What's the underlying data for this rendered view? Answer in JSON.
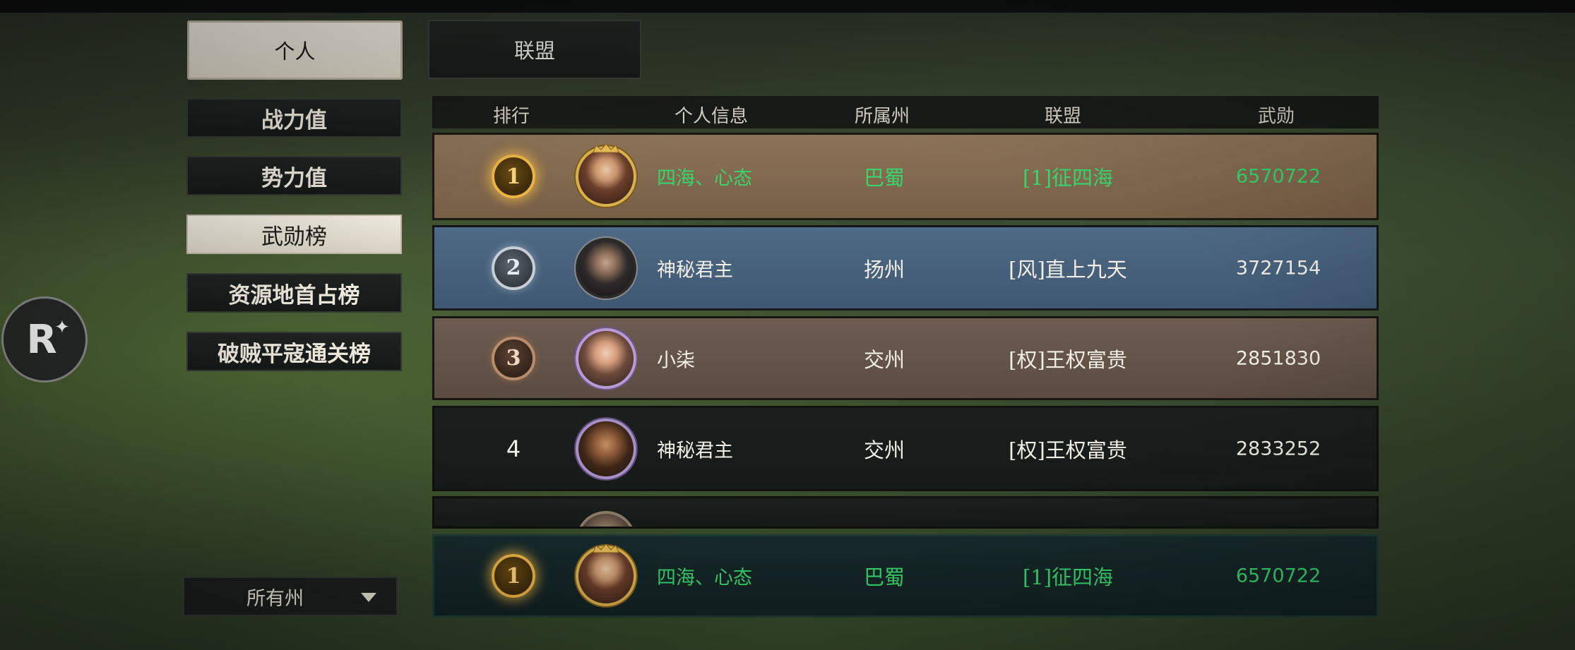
{
  "tabs": {
    "personal": "个人",
    "alliance": "联盟"
  },
  "sidebar": {
    "items": [
      {
        "label": "战力值",
        "active": false
      },
      {
        "label": "势力值",
        "active": false
      },
      {
        "label": "武勋榜",
        "active": true
      },
      {
        "label": "资源地首占榜",
        "active": false
      },
      {
        "label": "破贼平寇通关榜",
        "active": false
      }
    ]
  },
  "floating_button": {
    "label": "R",
    "icon": "sparkle-icon"
  },
  "filter": {
    "selected": "所有州",
    "icon": "dropdown-triangle-icon"
  },
  "table": {
    "headers": {
      "rank": "排行",
      "info": "个人信息",
      "state": "所属州",
      "alliance": "联盟",
      "score": "武勋"
    },
    "rows": [
      {
        "rank": "1",
        "name": "四海、心态",
        "state": "巴蜀",
        "alliance": "[1]征四海",
        "score": "6570722",
        "highlight": "green"
      },
      {
        "rank": "2",
        "name": "神秘君主",
        "state": "扬州",
        "alliance": "[风]直上九天",
        "score": "3727154",
        "highlight": "white"
      },
      {
        "rank": "3",
        "name": "小柒",
        "state": "交州",
        "alliance": "[权]王权富贵",
        "score": "2851830",
        "highlight": "white"
      },
      {
        "rank": "4",
        "name": "神秘君主",
        "state": "交州",
        "alliance": "[权]王权富贵",
        "score": "2833252",
        "highlight": "white"
      }
    ],
    "self_row": {
      "rank": "1",
      "name": "四海、心态",
      "state": "巴蜀",
      "alliance": "[1]征四海",
      "score": "6570722"
    }
  },
  "colors": {
    "highlight_green": "#39d46e",
    "rank1_bg": "#8d7457",
    "rank2_bg": "#4f6a86",
    "rank3_bg": "#6d5c51",
    "self_bg": "#172a2b"
  }
}
